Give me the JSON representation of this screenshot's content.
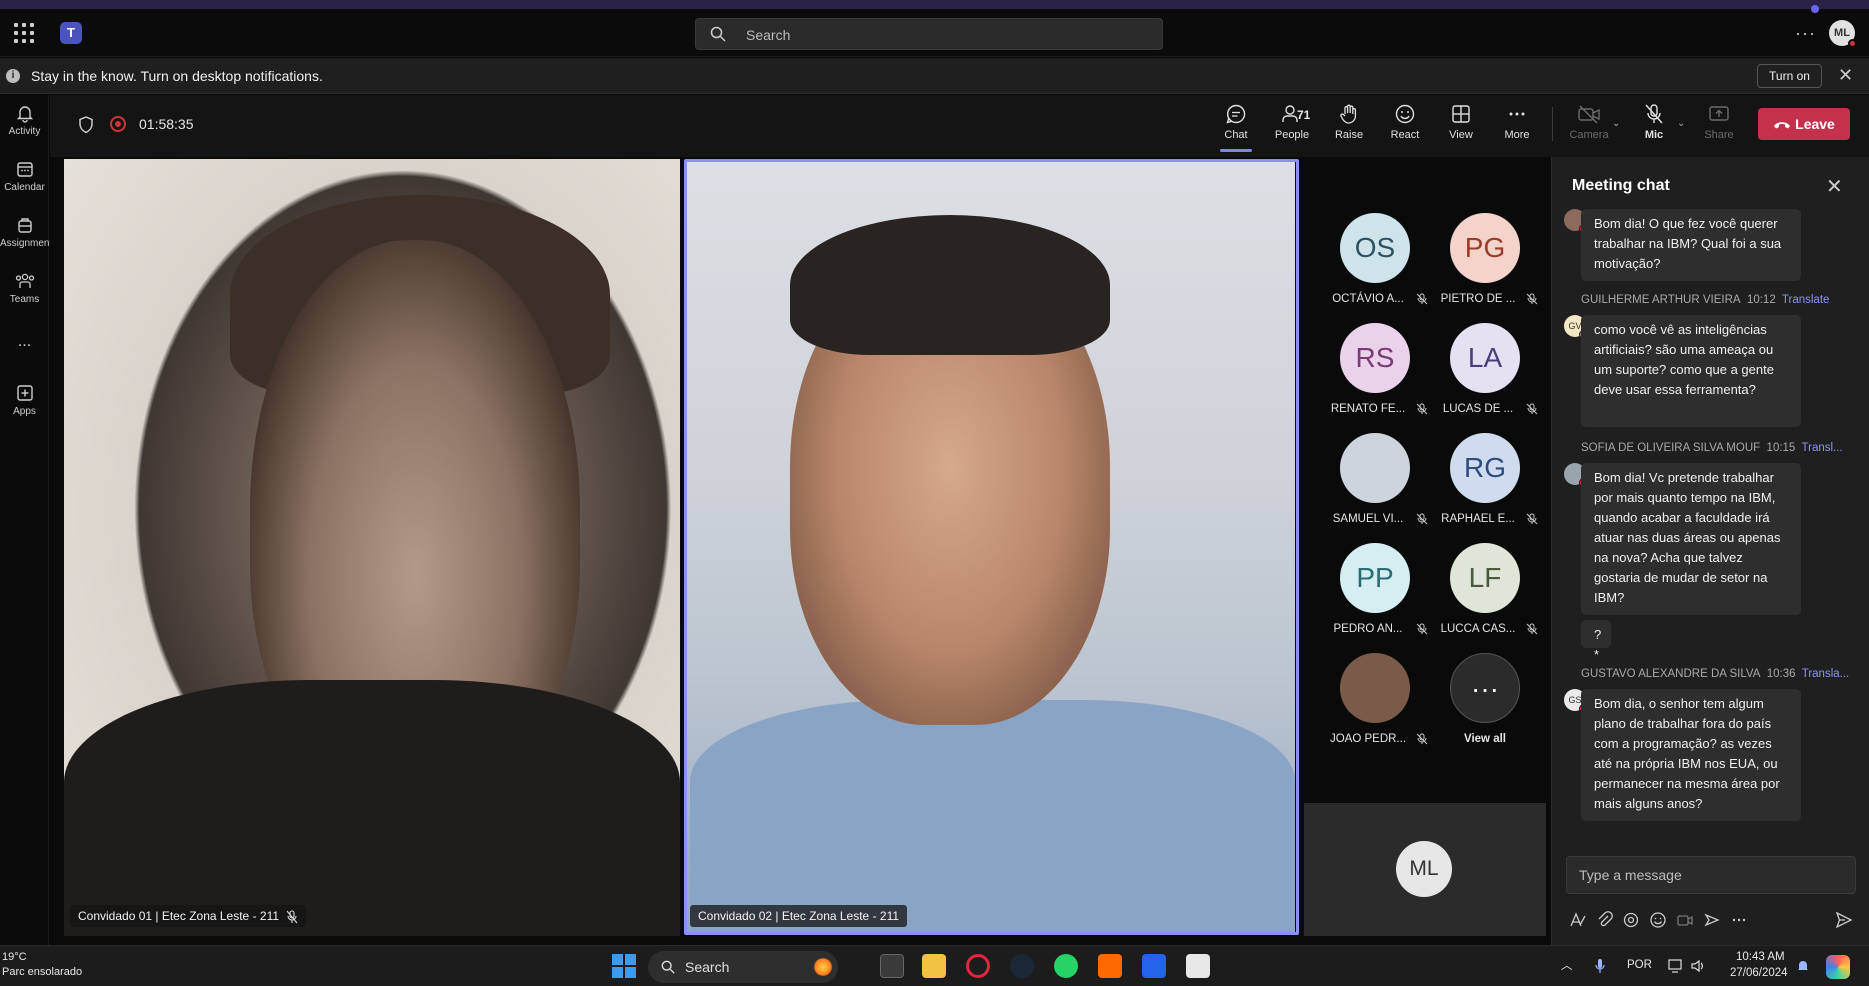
{
  "titlebar": {
    "search_placeholder": "Search",
    "app_logo": "teams-logo",
    "user_initials": "ML"
  },
  "banner": {
    "text": "Stay in the know. Turn on desktop notifications.",
    "turn_on_label": "Turn on"
  },
  "rail": {
    "items": [
      {
        "label": "Activity",
        "icon": "bell-icon"
      },
      {
        "label": "Calendar",
        "icon": "calendar-icon"
      },
      {
        "label": "Assignments",
        "icon": "assignments-icon"
      },
      {
        "label": "Teams",
        "icon": "teams-icon"
      },
      {
        "label": "...",
        "icon": "more-icon"
      },
      {
        "label": "Apps",
        "icon": "apps-icon"
      }
    ]
  },
  "meeting": {
    "timer": "01:58:35",
    "controls": {
      "chat": "Chat",
      "people": "People",
      "people_count": "71",
      "raise": "Raise",
      "react": "React",
      "view": "View",
      "more": "More",
      "camera": "Camera",
      "mic": "Mic",
      "share": "Share",
      "leave": "Leave"
    }
  },
  "videos": {
    "left_caption": "Convidado 01 | Etec Zona Leste - 211",
    "right_caption": "Convidado 02 | Etec Zona Leste - 211"
  },
  "participants": [
    {
      "initials": "OS",
      "name": "OCTÁVIO A...",
      "bg": "#cfe3ea",
      "fg": "#2c5364"
    },
    {
      "initials": "PG",
      "name": "PIETRO DE ...",
      "bg": "#f4d3cb",
      "fg": "#9b3b2a"
    },
    {
      "initials": "RS",
      "name": "RENATO FE...",
      "bg": "#ead3ea",
      "fg": "#7a3a78"
    },
    {
      "initials": "LA",
      "name": "LUCAS DE ...",
      "bg": "#e6e0f3",
      "fg": "#4b3f7a"
    },
    {
      "initials": "",
      "name": "SAMUEL VI...",
      "bg": "#cdd4dc",
      "fg": "#333"
    },
    {
      "initials": "RG",
      "name": "RAPHAEL E...",
      "bg": "#cfdcef",
      "fg": "#2f4d7a"
    },
    {
      "initials": "PP",
      "name": "PEDRO AN...",
      "bg": "#d5eef2",
      "fg": "#2a6d77"
    },
    {
      "initials": "LF",
      "name": "LUCCA CAS...",
      "bg": "#dfe5d8",
      "fg": "#4a5a3a"
    },
    {
      "initials": "",
      "name": "JOAO PEDR...",
      "bg": "#7a5a48",
      "fg": "#fff"
    },
    {
      "initials": "···",
      "name": "View all",
      "bg": "#2b2b2b",
      "fg": "#fff"
    }
  ],
  "self_view": {
    "initials": "ML"
  },
  "chat": {
    "title": "Meeting chat",
    "messages": [
      {
        "text": "Bom dia! O que fez você querer trabalhar na IBM? Qual foi a sua motivação?"
      },
      {
        "sender": "GUILHERME ARTHUR VIEIRA",
        "time": "10:12",
        "translate": "Translate",
        "avatar": "GV",
        "text": "como você vê as inteligências artificiais? são uma ameaça ou um suporte? como que a gente deve usar essa ferramenta?"
      },
      {
        "sender": "SOFIA DE OLIVEIRA SILVA MOUF",
        "time": "10:15",
        "translate": "Transl...",
        "text": "Bom dia! Vc pretende trabalhar por mais quanto tempo na IBM, quando acabar a faculdade irá atuar nas duas áreas ou apenas na nova? Acha que talvez gostaria de mudar de setor na IBM?"
      },
      {
        "text": "?*"
      },
      {
        "sender": "GUSTAVO ALEXANDRE DA SILVA",
        "time": "10:36",
        "translate": "Transla...",
        "avatar": "GS",
        "text": "Bom dia, o senhor tem algum plano de trabalhar fora do país com a programação? as vezes até na própria IBM nos EUA, ou permanecer na mesma área por mais alguns anos?"
      }
    ],
    "compose_placeholder": "Type a message"
  },
  "taskbar": {
    "weather_temp": "19°C",
    "weather_desc": "Parc ensolarado",
    "search_label": "Search",
    "lang": "POR",
    "time": "10:43 AM",
    "date": "27/06/2024"
  }
}
